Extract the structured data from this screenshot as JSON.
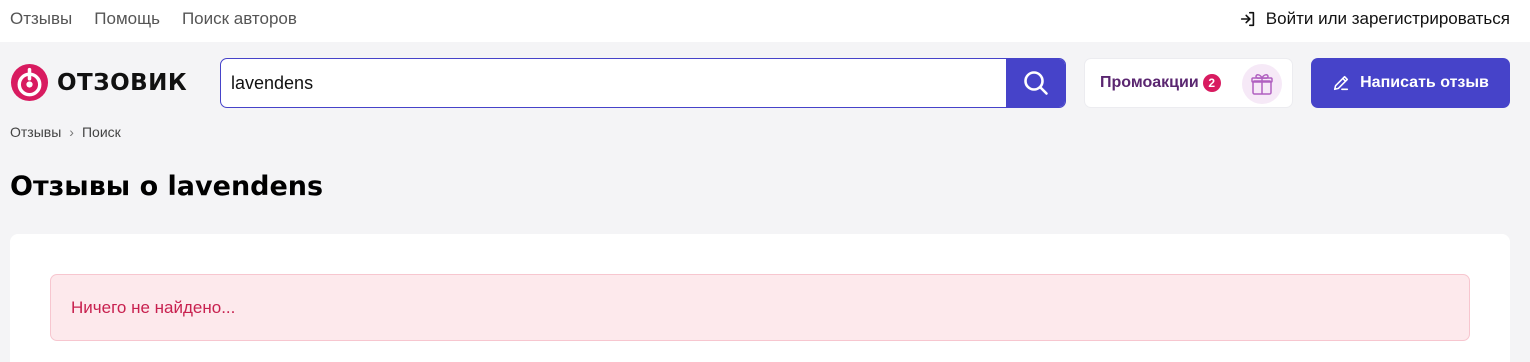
{
  "topbar": {
    "links": [
      "Отзывы",
      "Помощь",
      "Поиск авторов"
    ],
    "login_label": "Войти или зарегистрироваться",
    "login_icon": "login-arrow-icon"
  },
  "header": {
    "logo_text": "ОТЗОВИК",
    "search": {
      "value": "lavendens",
      "icon": "search-icon"
    },
    "promo": {
      "label": "Промоакции",
      "badge": "2",
      "icon": "gift-icon"
    },
    "write_review": {
      "label": "Написать отзыв",
      "icon": "pencil-icon"
    }
  },
  "breadcrumb": {
    "items": [
      "Отзывы",
      "Поиск"
    ],
    "separator": "›"
  },
  "main": {
    "title": "Отзывы о lavendens",
    "message": "Ничего не найдено..."
  },
  "colors": {
    "accent": "#4643c9",
    "brand": "#d81b60",
    "alert_bg": "#fde9ec",
    "alert_text": "#c8214f",
    "promo_text": "#5a2670"
  }
}
